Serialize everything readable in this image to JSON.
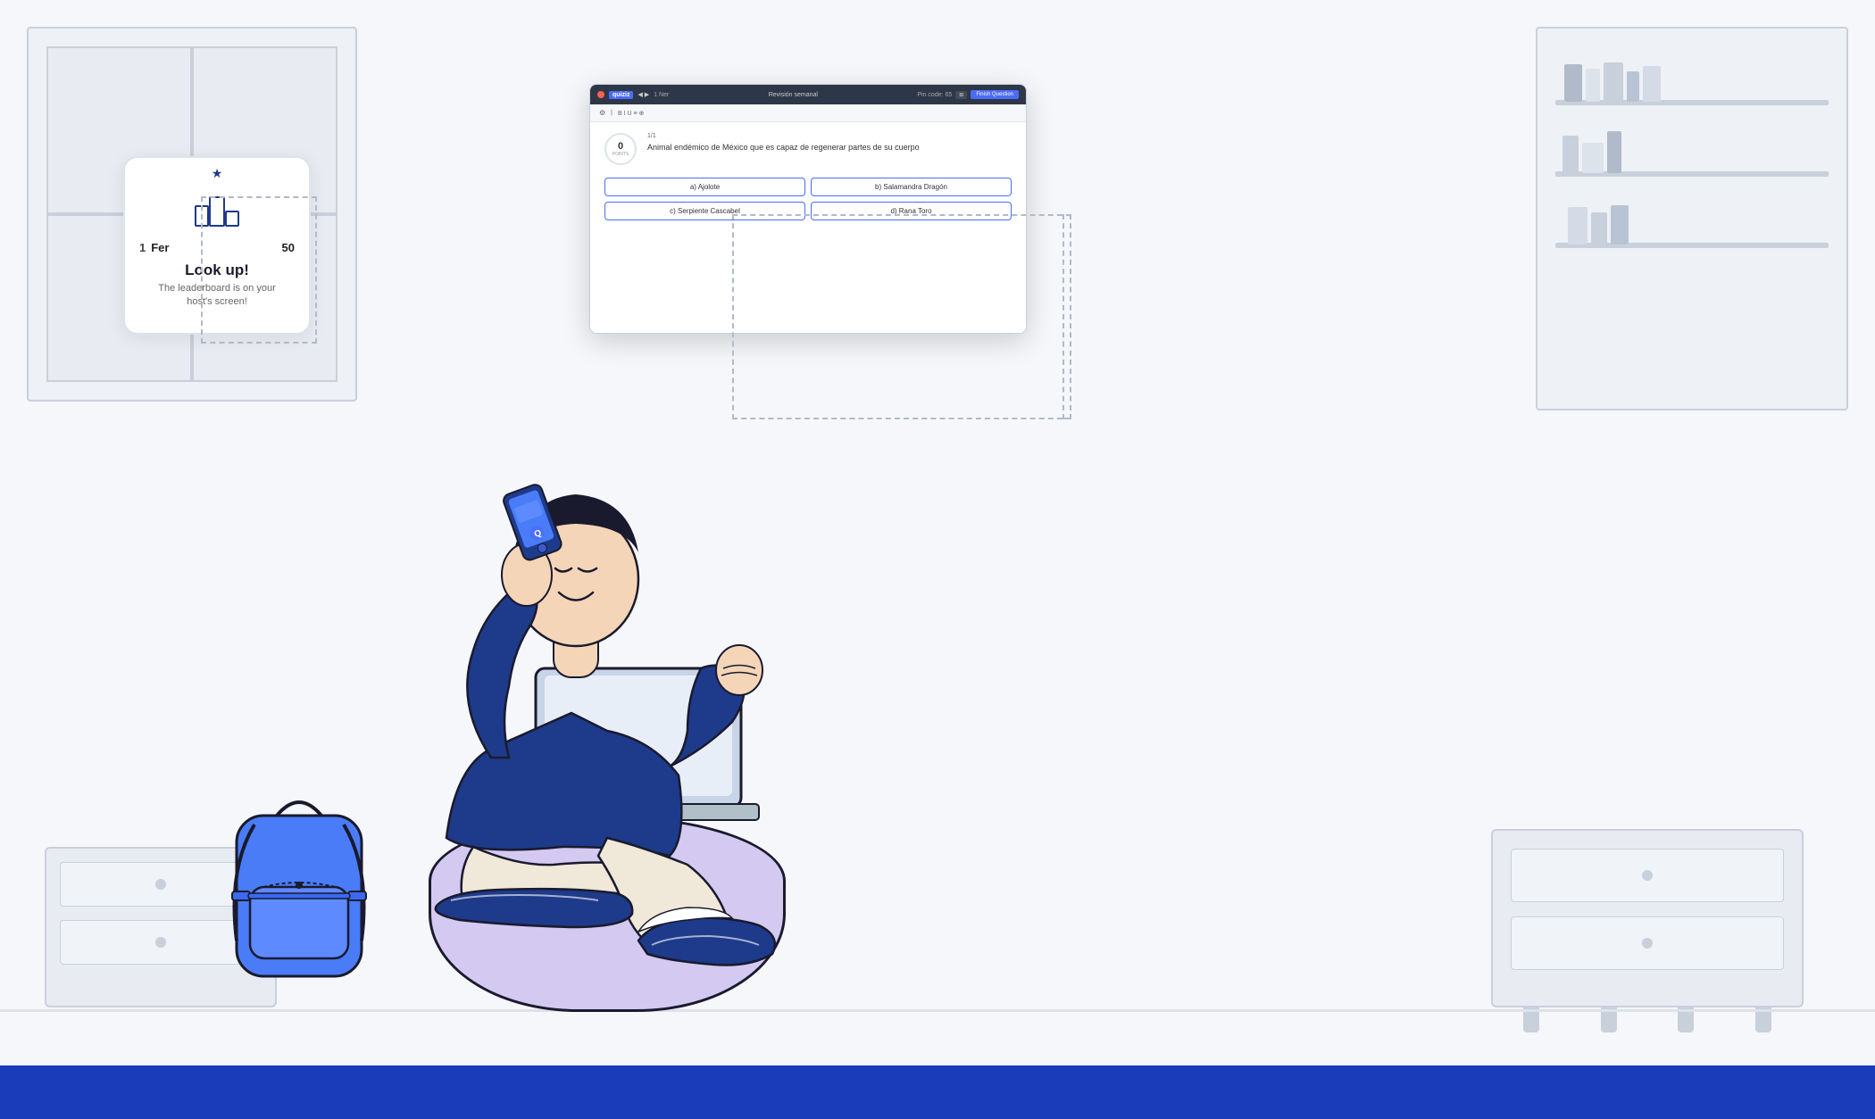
{
  "page": {
    "bg_color": "#f5f7fa",
    "bottom_bar_color": "#1a3cbb"
  },
  "leaderboard_card": {
    "rank": "1",
    "name": "Fer",
    "score": "50",
    "title": "Look up!",
    "subtitle_line1": "The leaderboard is on your",
    "subtitle_line2": "host's screen!"
  },
  "quiz_window": {
    "brand": "quiziz",
    "title_bar_title": "1 Ner",
    "center_title": "Revisión semanal",
    "pin_label": "Pin code: 65",
    "close_btn": "×",
    "finish_btn": "Finish Question",
    "timer_value": "0",
    "timer_sub": "POINTS",
    "question_number": "1/1",
    "question_text": "Animal endémico de México que es capaz de regenerar partes de su cuerpo",
    "options": [
      {
        "key": "a",
        "label": "a) Ajolote"
      },
      {
        "key": "b",
        "label": "b) Salamandra Dragón"
      },
      {
        "key": "c",
        "label": "c) Serpiente Cascabel"
      },
      {
        "key": "d",
        "label": "d) Rana Toro"
      }
    ]
  },
  "icons": {
    "star": "★",
    "close": "×",
    "grid": "⊞",
    "chevron_down": "▾"
  }
}
